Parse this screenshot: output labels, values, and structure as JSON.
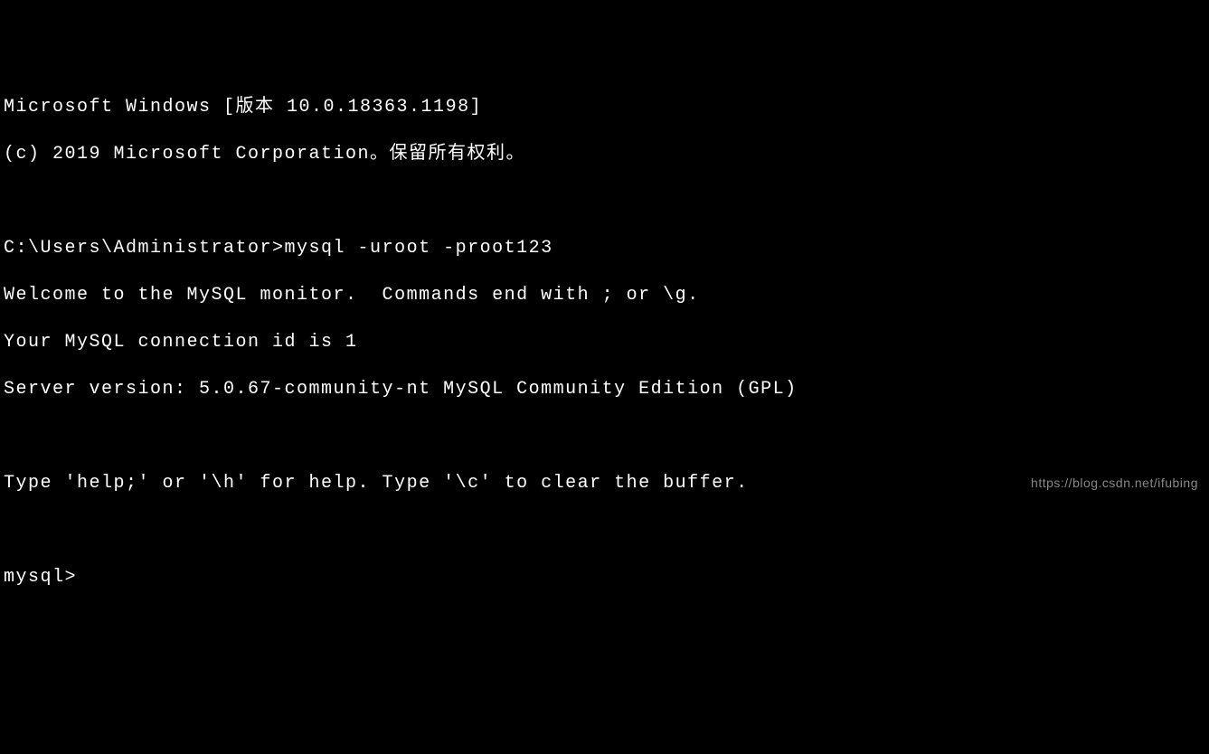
{
  "header": {
    "line1": "Microsoft Windows [版本 10.0.18363.1198]",
    "line2": "(c) 2019 Microsoft Corporation。保留所有权利。"
  },
  "prompt": {
    "path": "C:\\Users\\Administrator>",
    "command": "mysql -uroot -proot123"
  },
  "output": {
    "welcome": "Welcome to the MySQL monitor.  Commands end with ; or \\g.",
    "connection": "Your MySQL connection id is 1",
    "version": "Server version: 5.0.67-community-nt MySQL Community Edition (GPL)",
    "help": "Type 'help;' or '\\h' for help. Type '\\c' to clear the buffer."
  },
  "mysql_prompt": "mysql>",
  "watermark": "https://blog.csdn.net/ifubing"
}
